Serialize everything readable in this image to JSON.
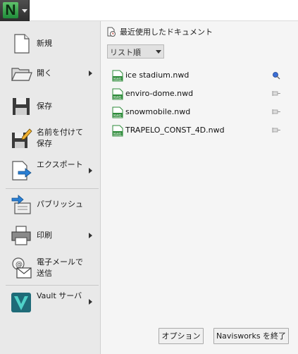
{
  "app": {
    "logo_letter": "N"
  },
  "menu": {
    "items": [
      {
        "label": "新規",
        "icon": "new-document-icon"
      },
      {
        "label": "開く",
        "icon": "open-folder-icon",
        "has_submenu": true
      },
      {
        "label": "保存",
        "icon": "floppy-disk-icon"
      },
      {
        "label": "名前を付けて保存",
        "icon": "save-as-icon"
      },
      {
        "label": "エクスポート",
        "icon": "export-icon",
        "has_submenu": true
      },
      {
        "label": "パブリッシュ",
        "icon": "publish-icon"
      },
      {
        "label": "印刷",
        "icon": "printer-icon",
        "has_submenu": true
      },
      {
        "label": "電子メールで送信",
        "icon": "email-icon"
      },
      {
        "label": "Vault サーバ",
        "icon": "vault-icon",
        "has_submenu": true
      }
    ]
  },
  "recent": {
    "header": "最近使用したドキュメント",
    "sort_value": "リスト順",
    "files": [
      {
        "name": "ice stadium.nwd",
        "pinned": true
      },
      {
        "name": "enviro-dome.nwd",
        "pinned": false
      },
      {
        "name": "snowmobile.nwd",
        "pinned": false
      },
      {
        "name": "TRAPELO_CONST_4D.nwd",
        "pinned": false
      }
    ],
    "file_icon_text": "NWD"
  },
  "buttons": {
    "options": "オプション",
    "exit": "Navisworks を終了"
  },
  "colors": {
    "menu_bg": "#e9e9e9",
    "pane_bg": "#f5f5f5",
    "logo_green": "#3aa64d",
    "file_icon_green": "#2e8b3a"
  }
}
